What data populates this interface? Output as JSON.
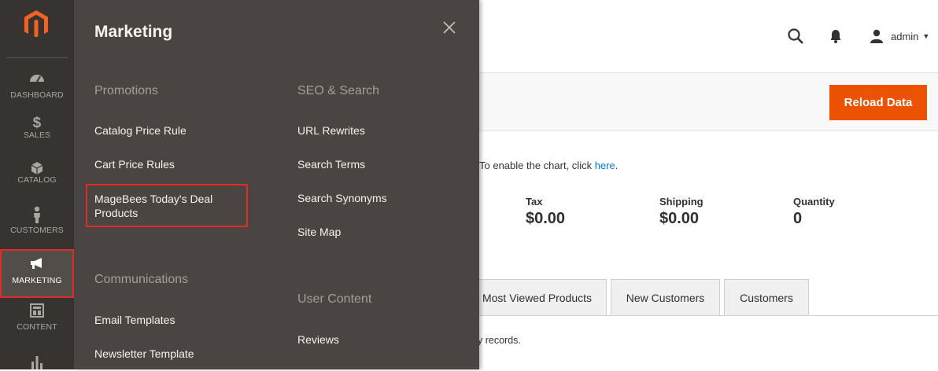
{
  "sidebar": {
    "items": [
      {
        "label": "Dashboard",
        "icon": "dashboard-icon"
      },
      {
        "label": "Sales",
        "icon": "dollar-icon"
      },
      {
        "label": "Catalog",
        "icon": "box-icon"
      },
      {
        "label": "Customers",
        "icon": "person-icon"
      },
      {
        "label": "Marketing",
        "icon": "megaphone-icon"
      },
      {
        "label": "Content",
        "icon": "layout-icon"
      },
      {
        "label": "",
        "icon": "bar-chart-icon"
      }
    ]
  },
  "header": {
    "user_name": "admin"
  },
  "action_bar": {
    "reload_label": "Reload Data"
  },
  "dashboard": {
    "chart_note_prefix": "To enable the chart, click ",
    "chart_note_link": "here",
    "chart_note_suffix": ".",
    "stats": [
      {
        "label": "Tax",
        "value": "$0.00"
      },
      {
        "label": "Shipping",
        "value": "$0.00"
      },
      {
        "label": "Quantity",
        "value": "0"
      }
    ],
    "tabs": [
      "Most Viewed Products",
      "New Customers",
      "Customers"
    ],
    "records_text": "y records."
  },
  "flyout": {
    "title": "Marketing",
    "sections": {
      "promotions": {
        "title": "Promotions",
        "links": [
          "Catalog Price Rule",
          "Cart Price Rules",
          "MageBees Today's Deal Products"
        ]
      },
      "communications": {
        "title": "Communications",
        "links": [
          "Email Templates",
          "Newsletter Template"
        ]
      },
      "seo": {
        "title": "SEO & Search",
        "links": [
          "URL Rewrites",
          "Search Terms",
          "Search Synonyms",
          "Site Map"
        ]
      },
      "user_content": {
        "title": "User Content",
        "links": [
          "Reviews"
        ]
      }
    }
  },
  "colors": {
    "sidebar_bg": "#373330",
    "flyout_bg": "#4a4542",
    "accent_orange": "#eb5202",
    "highlight_red": "#e02b27",
    "link_blue": "#007bdb"
  }
}
